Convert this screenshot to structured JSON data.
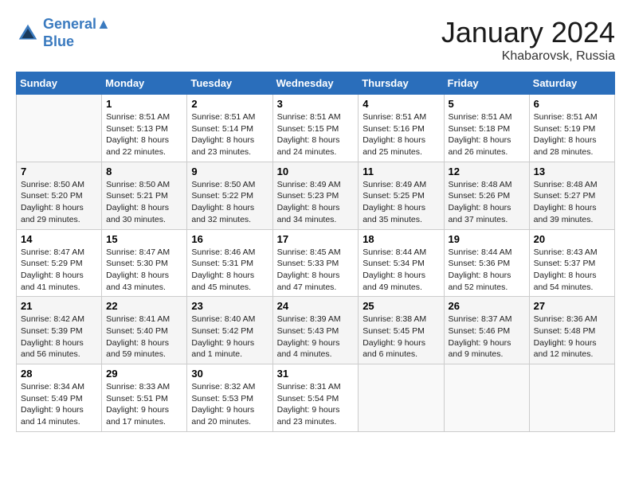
{
  "header": {
    "logo_line1": "General",
    "logo_line2": "Blue",
    "month": "January 2024",
    "location": "Khabarovsk, Russia"
  },
  "weekdays": [
    "Sunday",
    "Monday",
    "Tuesday",
    "Wednesday",
    "Thursday",
    "Friday",
    "Saturday"
  ],
  "weeks": [
    [
      {
        "day": "",
        "info": ""
      },
      {
        "day": "1",
        "info": "Sunrise: 8:51 AM\nSunset: 5:13 PM\nDaylight: 8 hours\nand 22 minutes."
      },
      {
        "day": "2",
        "info": "Sunrise: 8:51 AM\nSunset: 5:14 PM\nDaylight: 8 hours\nand 23 minutes."
      },
      {
        "day": "3",
        "info": "Sunrise: 8:51 AM\nSunset: 5:15 PM\nDaylight: 8 hours\nand 24 minutes."
      },
      {
        "day": "4",
        "info": "Sunrise: 8:51 AM\nSunset: 5:16 PM\nDaylight: 8 hours\nand 25 minutes."
      },
      {
        "day": "5",
        "info": "Sunrise: 8:51 AM\nSunset: 5:18 PM\nDaylight: 8 hours\nand 26 minutes."
      },
      {
        "day": "6",
        "info": "Sunrise: 8:51 AM\nSunset: 5:19 PM\nDaylight: 8 hours\nand 28 minutes."
      }
    ],
    [
      {
        "day": "7",
        "info": "Sunrise: 8:50 AM\nSunset: 5:20 PM\nDaylight: 8 hours\nand 29 minutes."
      },
      {
        "day": "8",
        "info": "Sunrise: 8:50 AM\nSunset: 5:21 PM\nDaylight: 8 hours\nand 30 minutes."
      },
      {
        "day": "9",
        "info": "Sunrise: 8:50 AM\nSunset: 5:22 PM\nDaylight: 8 hours\nand 32 minutes."
      },
      {
        "day": "10",
        "info": "Sunrise: 8:49 AM\nSunset: 5:23 PM\nDaylight: 8 hours\nand 34 minutes."
      },
      {
        "day": "11",
        "info": "Sunrise: 8:49 AM\nSunset: 5:25 PM\nDaylight: 8 hours\nand 35 minutes."
      },
      {
        "day": "12",
        "info": "Sunrise: 8:48 AM\nSunset: 5:26 PM\nDaylight: 8 hours\nand 37 minutes."
      },
      {
        "day": "13",
        "info": "Sunrise: 8:48 AM\nSunset: 5:27 PM\nDaylight: 8 hours\nand 39 minutes."
      }
    ],
    [
      {
        "day": "14",
        "info": "Sunrise: 8:47 AM\nSunset: 5:29 PM\nDaylight: 8 hours\nand 41 minutes."
      },
      {
        "day": "15",
        "info": "Sunrise: 8:47 AM\nSunset: 5:30 PM\nDaylight: 8 hours\nand 43 minutes."
      },
      {
        "day": "16",
        "info": "Sunrise: 8:46 AM\nSunset: 5:31 PM\nDaylight: 8 hours\nand 45 minutes."
      },
      {
        "day": "17",
        "info": "Sunrise: 8:45 AM\nSunset: 5:33 PM\nDaylight: 8 hours\nand 47 minutes."
      },
      {
        "day": "18",
        "info": "Sunrise: 8:44 AM\nSunset: 5:34 PM\nDaylight: 8 hours\nand 49 minutes."
      },
      {
        "day": "19",
        "info": "Sunrise: 8:44 AM\nSunset: 5:36 PM\nDaylight: 8 hours\nand 52 minutes."
      },
      {
        "day": "20",
        "info": "Sunrise: 8:43 AM\nSunset: 5:37 PM\nDaylight: 8 hours\nand 54 minutes."
      }
    ],
    [
      {
        "day": "21",
        "info": "Sunrise: 8:42 AM\nSunset: 5:39 PM\nDaylight: 8 hours\nand 56 minutes."
      },
      {
        "day": "22",
        "info": "Sunrise: 8:41 AM\nSunset: 5:40 PM\nDaylight: 8 hours\nand 59 minutes."
      },
      {
        "day": "23",
        "info": "Sunrise: 8:40 AM\nSunset: 5:42 PM\nDaylight: 9 hours\nand 1 minute."
      },
      {
        "day": "24",
        "info": "Sunrise: 8:39 AM\nSunset: 5:43 PM\nDaylight: 9 hours\nand 4 minutes."
      },
      {
        "day": "25",
        "info": "Sunrise: 8:38 AM\nSunset: 5:45 PM\nDaylight: 9 hours\nand 6 minutes."
      },
      {
        "day": "26",
        "info": "Sunrise: 8:37 AM\nSunset: 5:46 PM\nDaylight: 9 hours\nand 9 minutes."
      },
      {
        "day": "27",
        "info": "Sunrise: 8:36 AM\nSunset: 5:48 PM\nDaylight: 9 hours\nand 12 minutes."
      }
    ],
    [
      {
        "day": "28",
        "info": "Sunrise: 8:34 AM\nSunset: 5:49 PM\nDaylight: 9 hours\nand 14 minutes."
      },
      {
        "day": "29",
        "info": "Sunrise: 8:33 AM\nSunset: 5:51 PM\nDaylight: 9 hours\nand 17 minutes."
      },
      {
        "day": "30",
        "info": "Sunrise: 8:32 AM\nSunset: 5:53 PM\nDaylight: 9 hours\nand 20 minutes."
      },
      {
        "day": "31",
        "info": "Sunrise: 8:31 AM\nSunset: 5:54 PM\nDaylight: 9 hours\nand 23 minutes."
      },
      {
        "day": "",
        "info": ""
      },
      {
        "day": "",
        "info": ""
      },
      {
        "day": "",
        "info": ""
      }
    ]
  ]
}
